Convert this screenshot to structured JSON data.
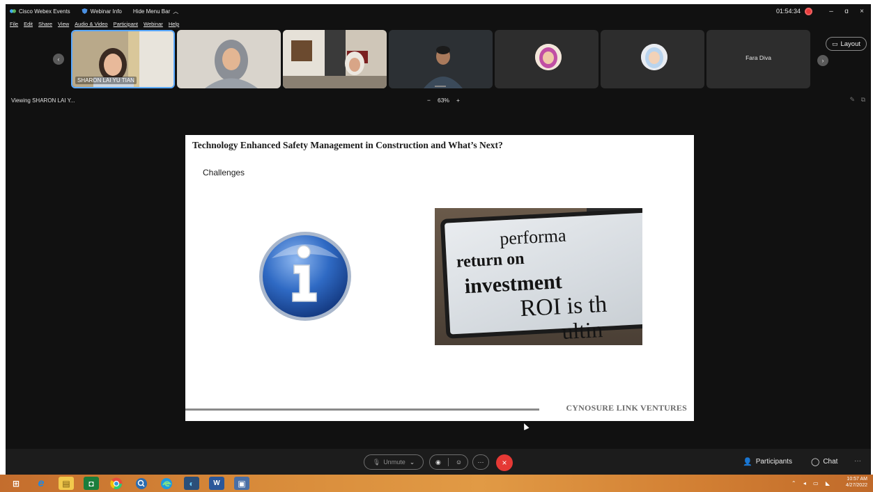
{
  "titlebar": {
    "app_name": "Cisco Webex Events",
    "webinar_info": "Webinar Info",
    "hide_menu": "Hide Menu Bar",
    "timer": "01:54:34",
    "minimize": "–",
    "restore": "ɑ",
    "close": "×"
  },
  "menu": {
    "items": [
      "File",
      "Edit",
      "Share",
      "View",
      "Audio & Video",
      "Participant",
      "Webinar",
      "Help"
    ]
  },
  "filmstrip": {
    "participants": [
      {
        "name": "SHARON LAI YU TIAN",
        "type": "video"
      },
      {
        "name": "",
        "type": "video"
      },
      {
        "name": "",
        "type": "video"
      },
      {
        "name": "",
        "type": "video"
      },
      {
        "name": "",
        "type": "avatar"
      },
      {
        "name": "",
        "type": "avatar"
      },
      {
        "name": "Fara Diva",
        "type": "name"
      }
    ],
    "prev_icon": "‹",
    "next_icon": "›",
    "layout_label": "Layout"
  },
  "viewing": {
    "label": "Viewing SHARON LAI Y...",
    "zoom_minus": "−",
    "zoom_value": "63%",
    "zoom_plus": "+"
  },
  "slide": {
    "title": "Technology Enhanced Safety Management in Construction and What’s Next?",
    "subtitle": "Challenges",
    "image_lines": [
      "performa",
      "return on",
      "investment",
      "ROI is th",
      "ultin"
    ],
    "footer": "CYNOSURE LINK VENTURES"
  },
  "controls": {
    "unmute_label": "Unmute",
    "more_label": "···",
    "end_label": "×",
    "participants_label": "Participants",
    "chat_label": "Chat",
    "overflow_label": "···"
  },
  "taskbar": {
    "time": "10:57 AM",
    "date": "4/27/2022"
  },
  "colors": {
    "accent_blue": "#5aa9ff",
    "end_red": "#e53935",
    "record_red": "#ea3b3b"
  }
}
